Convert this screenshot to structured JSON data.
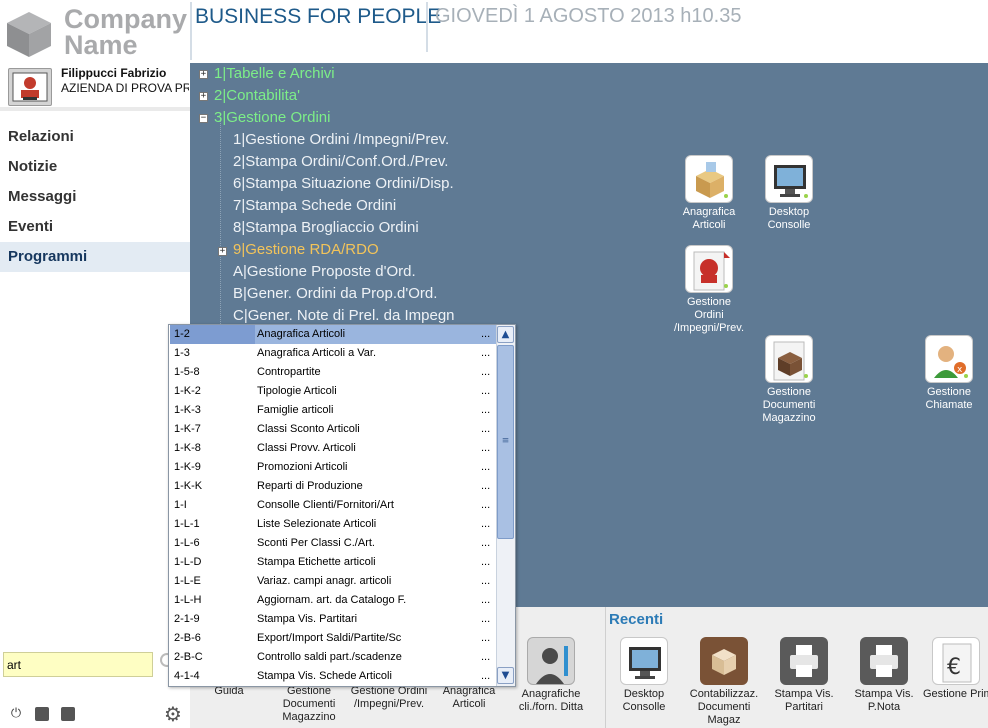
{
  "header": {
    "logo_line1": "Company",
    "logo_line2": "Name",
    "tagline": "BUSINESS FOR PEOPLE",
    "datetime": "GIOVEDÌ 1 AGOSTO 2013 h10.35"
  },
  "user": {
    "name": "Filippucci Fabrizio",
    "company": "AZIENDA DI PROVA PR"
  },
  "sidebar": {
    "items": [
      {
        "label": "Relazioni",
        "active": false
      },
      {
        "label": "Notizie",
        "active": false
      },
      {
        "label": "Messaggi",
        "active": false
      },
      {
        "label": "Eventi",
        "active": false
      },
      {
        "label": "Programmi",
        "active": true
      }
    ],
    "search_value": "art"
  },
  "tree": {
    "level1": [
      {
        "label": "1|Tabelle e Archivi",
        "expander": "+"
      },
      {
        "label": "2|Contabilita'",
        "expander": "+"
      },
      {
        "label": "3|Gestione Ordini",
        "expander": "−"
      }
    ],
    "children": [
      {
        "label": "1|Gestione Ordini /Impegni/Prev."
      },
      {
        "label": "2|Stampa Ordini/Conf.Ord./Prev."
      },
      {
        "label": "6|Stampa Situazione Ordini/Disp."
      },
      {
        "label": "7|Stampa Schede Ordini"
      },
      {
        "label": "8|Stampa Brogliaccio Ordini"
      },
      {
        "label": "9|Gestione RDA/RDO"
      },
      {
        "label": "A|Gestione Proposte d'Ord."
      },
      {
        "label": "B|Gener. Ordini da Prop.d'Ord."
      },
      {
        "label": "C|Gener. Note di Prel. da Impegn"
      }
    ]
  },
  "desktop_icons": [
    {
      "label": "Anagrafica Articoli",
      "icon": "box-icon"
    },
    {
      "label": "Desktop Consolle",
      "icon": "monitor-icon"
    },
    {
      "label": "Gestione Ordini /Impegni/Prev.",
      "icon": "orders-icon"
    },
    {
      "label": "Gestione Documenti Magazzino",
      "icon": "warehouse-docs-icon"
    },
    {
      "label": "Gestione Chiamate",
      "icon": "support-calls-icon"
    }
  ],
  "dock": {
    "left_items": [
      {
        "label": "Guida"
      },
      {
        "label": "Gestione Documenti Magazzino"
      },
      {
        "label": "Gestione Ordini /Impegni/Prev."
      },
      {
        "label": "Anagrafica Articoli"
      },
      {
        "label": "Anagrafiche cli./forn. Ditta"
      }
    ],
    "recent_title": "Recenti",
    "recent_items": [
      {
        "label": "Desktop Consolle"
      },
      {
        "label": "Contabilizzaz. Documenti Magaz"
      },
      {
        "label": "Stampa Vis. Partitari"
      },
      {
        "label": "Stampa Vis. P.Nota"
      },
      {
        "label": "Gestione Prima Nota"
      }
    ]
  },
  "dropdown": {
    "rows": [
      {
        "code": "1-2",
        "desc": "Anagrafica Articoli",
        "more": "...",
        "selected": true
      },
      {
        "code": "1-3",
        "desc": "Anagrafica Articoli a Var.",
        "more": "..."
      },
      {
        "code": "1-5-8",
        "desc": "Contropartite",
        "more": "..."
      },
      {
        "code": "1-K-2",
        "desc": "Tipologie Articoli",
        "more": "..."
      },
      {
        "code": "1-K-3",
        "desc": "Famiglie articoli",
        "more": "..."
      },
      {
        "code": "1-K-7",
        "desc": "Classi Sconto Articoli",
        "more": "..."
      },
      {
        "code": "1-K-8",
        "desc": "Classi Provv. Articoli",
        "more": "..."
      },
      {
        "code": "1-K-9",
        "desc": "Promozioni Articoli",
        "more": "..."
      },
      {
        "code": "1-K-K",
        "desc": "Reparti di Produzione",
        "more": "..."
      },
      {
        "code": "1-I",
        "desc": "Consolle Clienti/Fornitori/Art",
        "more": "..."
      },
      {
        "code": "1-L-1",
        "desc": "Liste Selezionate Articoli",
        "more": "..."
      },
      {
        "code": "1-L-6",
        "desc": "Sconti Per Classi C./Art.",
        "more": "..."
      },
      {
        "code": "1-L-D",
        "desc": "Stampa Etichette articoli",
        "more": "..."
      },
      {
        "code": "1-L-E",
        "desc": "Variaz. campi anagr. articoli",
        "more": "..."
      },
      {
        "code": "1-L-H",
        "desc": "Aggiornam. art. da Catalogo F.",
        "more": "..."
      },
      {
        "code": "2-1-9",
        "desc": "Stampa Vis. Partitari",
        "more": "..."
      },
      {
        "code": "2-B-6",
        "desc": "Export/Import Saldi/Partite/Sc",
        "more": "..."
      },
      {
        "code": "2-B-C",
        "desc": "Controllo saldi part./scadenze",
        "more": "..."
      },
      {
        "code": "4-1-4",
        "desc": "Stampa Vis. Schede Articoli",
        "more": "..."
      }
    ]
  }
}
